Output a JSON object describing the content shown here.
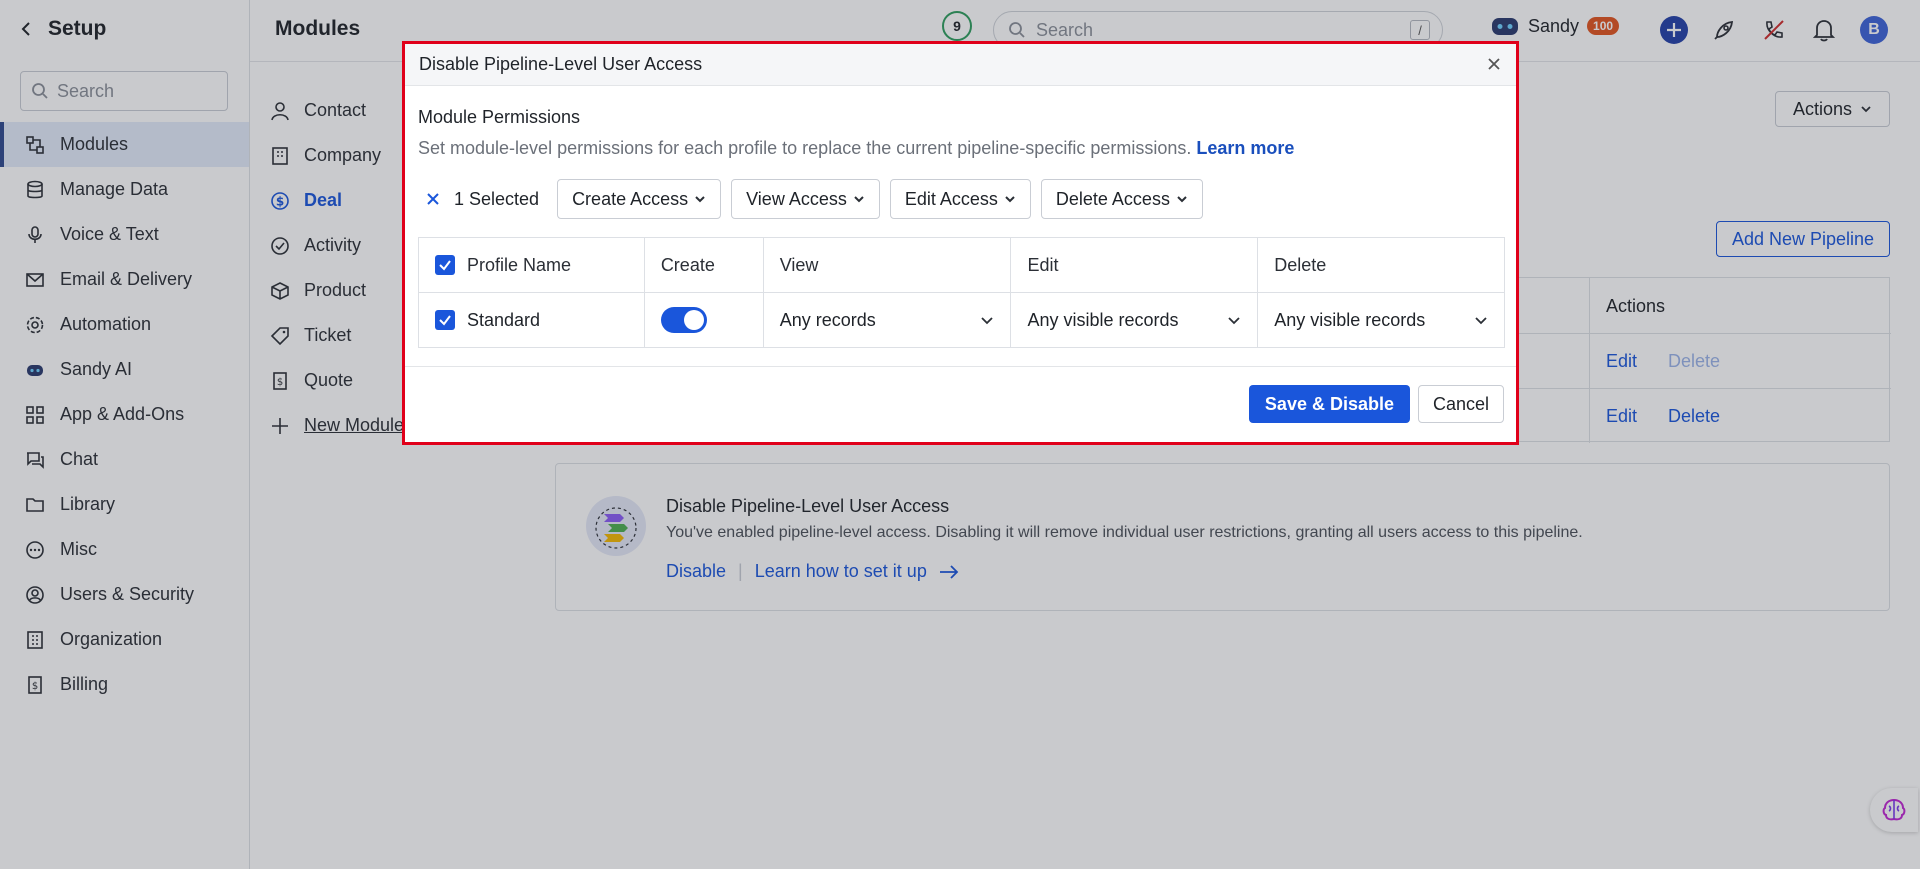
{
  "sidebar": {
    "title": "Setup",
    "search_placeholder": "Search",
    "items": [
      {
        "label": "Modules",
        "icon": "modules-icon",
        "active": true
      },
      {
        "label": "Manage Data",
        "icon": "database-icon"
      },
      {
        "label": "Voice & Text",
        "icon": "microphone-icon"
      },
      {
        "label": "Email & Delivery",
        "icon": "mail-icon"
      },
      {
        "label": "Automation",
        "icon": "automation-icon"
      },
      {
        "label": "Sandy AI",
        "icon": "robot-icon"
      },
      {
        "label": "App & Add-Ons",
        "icon": "apps-grid-icon"
      },
      {
        "label": "Chat",
        "icon": "chat-icon"
      },
      {
        "label": "Library",
        "icon": "folder-icon"
      },
      {
        "label": "Misc",
        "icon": "more-icon"
      },
      {
        "label": "Users & Security",
        "icon": "user-circle-icon"
      },
      {
        "label": "Organization",
        "icon": "building-icon"
      },
      {
        "label": "Billing",
        "icon": "dollar-doc-icon"
      }
    ]
  },
  "header": {
    "title": "Modules",
    "counter": "9",
    "search_placeholder": "Search",
    "search_shortcut": "/",
    "user_label": "Sandy",
    "badge": "100",
    "avatar": "B"
  },
  "modules_nav": {
    "items": [
      {
        "label": "Contact"
      },
      {
        "label": "Company"
      },
      {
        "label": "Deal",
        "active": true
      },
      {
        "label": "Activity"
      },
      {
        "label": "Product"
      },
      {
        "label": "Ticket"
      },
      {
        "label": "Quote"
      },
      {
        "label": "New Module"
      }
    ]
  },
  "background": {
    "actions_button": "Actions",
    "add_pipeline_button": "Add New Pipeline",
    "table_actions_header": "Actions",
    "row1": {
      "edit": "Edit",
      "delete": "Delete"
    },
    "row2": {
      "edit": "Edit",
      "delete": "Delete"
    },
    "info_card": {
      "title": "Disable Pipeline-Level User Access",
      "desc": "You've enabled pipeline-level access. Disabling it will remove individual user restrictions, granting all users access to this pipeline.",
      "disable_link": "Disable",
      "learn_link": "Learn how to set it up"
    }
  },
  "modal": {
    "title": "Disable Pipeline-Level User Access",
    "section_title": "Module Permissions",
    "section_desc": "Set module-level permissions for each profile to replace the current pipeline-specific permissions.",
    "learn_more": "Learn more",
    "selected_count": "1 Selected",
    "bulk_actions": [
      "Create Access",
      "View Access",
      "Edit Access",
      "Delete Access"
    ],
    "table": {
      "headers": [
        "Profile Name",
        "Create",
        "View",
        "Edit",
        "Delete"
      ],
      "rows": [
        {
          "profile": "Standard",
          "create": true,
          "view": "Any records",
          "edit": "Any visible records",
          "delete": "Any visible records"
        }
      ]
    },
    "save_button": "Save & Disable",
    "cancel_button": "Cancel"
  },
  "colors": {
    "primary": "#1a56db",
    "highlight_border": "#e0001a",
    "badge": "#e2541f"
  }
}
